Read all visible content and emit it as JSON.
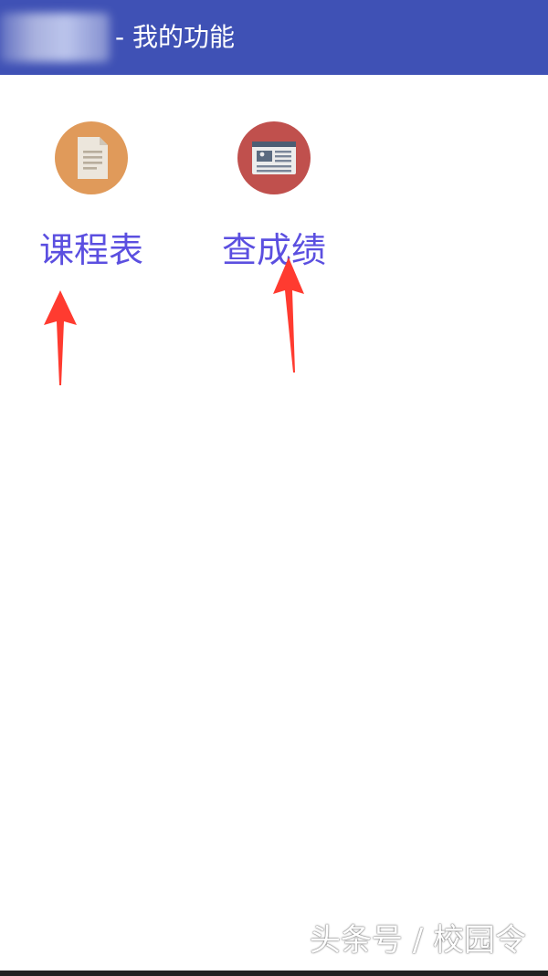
{
  "app_bar": {
    "title": "- 我的功能",
    "background": "#3f51b5"
  },
  "features": [
    {
      "label": "课程表",
      "icon": "document-icon",
      "icon_color": "#e09a5a"
    },
    {
      "label": "查成绩",
      "icon": "newspaper-icon",
      "icon_color": "#c0504d"
    }
  ],
  "label_color": "#5b4fe0",
  "annotation_color": "#ff3b30",
  "watermark": "头条号 / 校园令"
}
